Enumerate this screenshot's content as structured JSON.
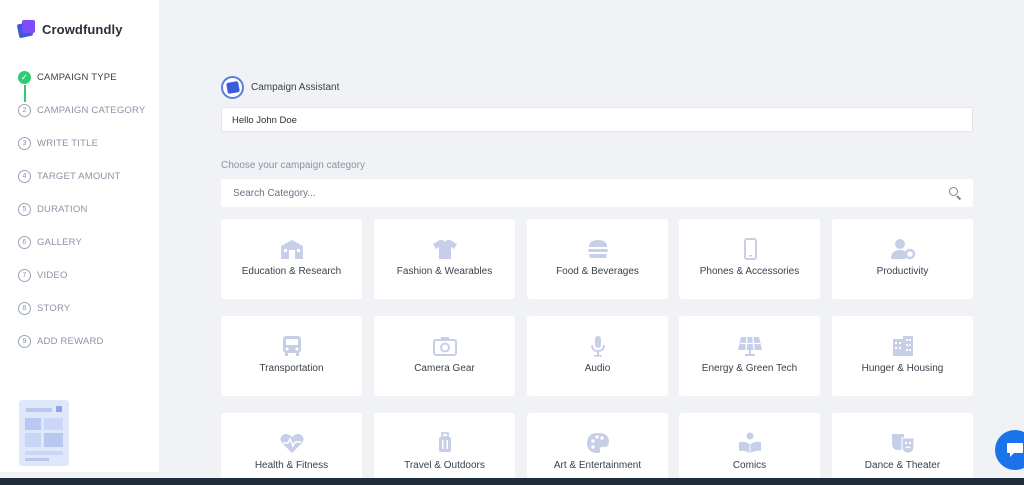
{
  "brand": {
    "name": "Crowdfundly"
  },
  "steps": [
    {
      "label": "CAMPAIGN TYPE",
      "marker": "✓",
      "state": "done"
    },
    {
      "label": "CAMPAIGN CATEGORY",
      "marker": "2",
      "state": "current"
    },
    {
      "label": "WRITE TITLE",
      "marker": "3",
      "state": "todo"
    },
    {
      "label": "TARGET AMOUNT",
      "marker": "4",
      "state": "todo"
    },
    {
      "label": "DURATION",
      "marker": "5",
      "state": "todo"
    },
    {
      "label": "GALLERY",
      "marker": "6",
      "state": "todo"
    },
    {
      "label": "VIDEO",
      "marker": "7",
      "state": "todo"
    },
    {
      "label": "STORY",
      "marker": "8",
      "state": "todo"
    },
    {
      "label": "ADD REWARD",
      "marker": "9",
      "state": "todo"
    }
  ],
  "assistant": {
    "title": "Campaign Assistant",
    "message": "Hello John Doe"
  },
  "category": {
    "prompt": "Choose your campaign category",
    "search_placeholder": "Search Category...",
    "items": [
      {
        "label": "Education & Research",
        "icon": "school-icon"
      },
      {
        "label": "Fashion & Wearables",
        "icon": "tshirt-icon"
      },
      {
        "label": "Food & Beverages",
        "icon": "burger-icon"
      },
      {
        "label": "Phones & Accessories",
        "icon": "phone-icon"
      },
      {
        "label": "Productivity",
        "icon": "user-gear-icon"
      },
      {
        "label": "Transportation",
        "icon": "bus-icon"
      },
      {
        "label": "Camera Gear",
        "icon": "camera-icon"
      },
      {
        "label": "Audio",
        "icon": "microphone-icon"
      },
      {
        "label": "Energy & Green Tech",
        "icon": "solar-panel-icon"
      },
      {
        "label": "Hunger & Housing",
        "icon": "building-icon"
      },
      {
        "label": "Health & Fitness",
        "icon": "heartbeat-icon"
      },
      {
        "label": "Travel & Outdoors",
        "icon": "luggage-icon"
      },
      {
        "label": "Art & Entertainment",
        "icon": "palette-icon"
      },
      {
        "label": "Comics",
        "icon": "book-reader-icon"
      },
      {
        "label": "Dance & Theater",
        "icon": "theater-masks-icon"
      }
    ]
  },
  "colors": {
    "accent": "#3b5bdb",
    "done": "#2ecc71",
    "icon": "#c7cfe8",
    "chat": "#1a73e8",
    "background": "#f1f2f6"
  }
}
